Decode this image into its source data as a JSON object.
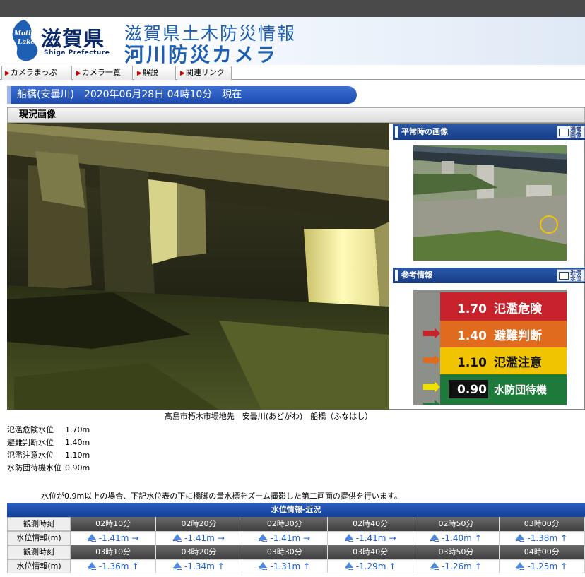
{
  "header": {
    "logo_kanji": "滋賀県",
    "logo_mark_text": "Mother Lake",
    "logo_en": "Shiga Prefecture",
    "title_line1": "滋賀県土木防災情報",
    "title_line2": "河川防災カメラ"
  },
  "nav": {
    "items": [
      {
        "label": "カメラまっぷ"
      },
      {
        "label": "カメラ一覧"
      },
      {
        "label": "解説"
      },
      {
        "label": "関連リンク"
      }
    ]
  },
  "camera": {
    "title": "船橋(安曇川)　2020年06月28日 04時10分　現在",
    "section_label": "現況画像"
  },
  "side": {
    "normal_title": "平常時の画像",
    "normal_button": "通常画像",
    "ref_title": "参考情報",
    "ref_button": "近傍水位局"
  },
  "reference_board": {
    "rows": [
      {
        "value": "1.70",
        "label": "氾濫危険",
        "color": "#c8232c"
      },
      {
        "value": "1.40",
        "label": "避難判断",
        "color": "#e06a1e"
      },
      {
        "value": "1.10",
        "label": "氾濫注意",
        "color": "#f0c400"
      },
      {
        "value": "0.90",
        "label": "水防団待機",
        "color": "#1e7a3a"
      }
    ]
  },
  "caption": "高島市朽木市場地先　安曇川(あどがわ)　船橋（ふなはし）",
  "levels": [
    {
      "name": "氾濫危険水位",
      "value": "1.70m"
    },
    {
      "name": "避難判断水位",
      "value": "1.40m"
    },
    {
      "name": "氾濫注意水位",
      "value": "1.10m"
    },
    {
      "name": "水防団待機水位",
      "value": "0.90m"
    }
  ],
  "notice": "水位が0.9m以上の場合、下記水位表の下に橋脚の量水標をズーム撮影した第二画面の提供を行います。",
  "water_table": {
    "title": "水位情報-近況",
    "time_label": "観測時刻",
    "value_label": "水位情報(m)",
    "rows": [
      {
        "times": [
          "02時10分",
          "02時20分",
          "02時30分",
          "02時40分",
          "02時50分",
          "03時00分"
        ],
        "values": [
          "-1.41m",
          "-1.41m",
          "-1.41m",
          "-1.41m",
          "-1.40m",
          "-1.38m"
        ],
        "trends": [
          "→",
          "→",
          "→",
          "→",
          "↑",
          "↑"
        ]
      },
      {
        "times": [
          "03時10分",
          "03時20分",
          "03時30分",
          "03時40分",
          "03時50分",
          "04時00分"
        ],
        "values": [
          "-1.36m",
          "-1.34m",
          "-1.31m",
          "-1.29m",
          "-1.26m",
          "-1.25m"
        ],
        "trends": [
          "↑",
          "↑",
          "↑",
          "↑",
          "↑",
          "↑"
        ]
      }
    ]
  }
}
